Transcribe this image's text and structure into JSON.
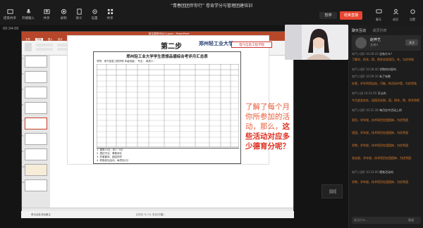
{
  "meeting": {
    "title": "“青春团团伴你行” 卷肯学分与管理团建培训",
    "time": "00:34:00"
  },
  "toolbar": {
    "items": [
      {
        "label": "结束共享"
      },
      {
        "label": "开播输入"
      },
      {
        "label": "共享"
      },
      {
        "label": "录制"
      },
      {
        "label": "讲义"
      },
      {
        "label": "设置"
      },
      {
        "label": "共享"
      }
    ],
    "live_label": "暂停",
    "end_label": "结束直播",
    "right_items": [
      {
        "label": "聊天"
      },
      {
        "label": "成员"
      },
      {
        "label": "设置"
      }
    ]
  },
  "ppt": {
    "window_title": "新生德育评价(1).pptx - PowerPoint",
    "tabs": [
      "文件",
      "开始",
      "插入",
      "设计",
      "切换",
      "动画",
      "幻灯片放映",
      "审阅",
      "视图"
    ],
    "slide_numbers": [
      "3",
      "4",
      "5",
      "6",
      "7",
      "8",
      "9",
      "10",
      "11"
    ],
    "status": "单击此处添加备注",
    "bottom_status": "幻灯片 9 / 21  中文(中国)"
  },
  "slide": {
    "heading": "第二步",
    "univ_logo": "郑州轻工业大学",
    "college_logo": "电气信息工程学院",
    "form_title": "郑州轻工业大学学生思想品德综合考评月汇总表",
    "form_meta": "学院：电气信息工程学院    年级班级：    专业：    填表人：",
    "form_foot": [
      "1. 德育15分，扣1~5分",
      "2. 遵纪守法、尊敬师长",
      "3. 热爱集体、团结同学",
      "4. 积极参加活动，每项加1分",
      "5. 其他"
    ],
    "callout_1": "了解了每个月你所参加的活动，那么，",
    "callout_2": "这些活动对应多少德育分呢？"
  },
  "panel": {
    "tab1": "聊天互动",
    "tab2": "成员列表",
    "host": {
      "name": "赵梓艺",
      "role": "主讲人"
    },
    "follow_label": "关注",
    "messages": [
      {
        "name": "电气二班0 10:28:22",
        "text": "还有什么？",
        "orange": false
      },
      {
        "name": "",
        "text": "了解学，积沐，院，院系实验项目，年，为优秀啥",
        "orange": true
      },
      {
        "name": "电气二班0 10:28:40",
        "text": "学院的内容吗",
        "orange": false
      },
      {
        "name": "电气二班0 10:29:10",
        "text": "有了有数",
        "orange": false
      },
      {
        "name": "",
        "text": "在啥，学年利用自由，可能，的活动中是，为优秀啥",
        "orange": true
      },
      {
        "name": "电气二班 10:31:05",
        "text": "可以的",
        "orange": false
      },
      {
        "name": "",
        "text": "今月会会实在，班团活动到，团，积沐，院，积学到吧",
        "orange": true
      },
      {
        "name": "电气二班0 10:31:38",
        "text": "每月在中活动上的",
        "orange": false
      },
      {
        "name": "",
        "text": "党员，学年程，技术项目在团团体，为优秀团",
        "orange": true
      },
      {
        "name": "",
        "text": "班团，学年程，技术项目在团团体，为优秀团",
        "orange": true
      },
      {
        "name": "",
        "text": "学院，学年程，技术项目在团团体，为优秀团",
        "orange": true
      },
      {
        "name": "",
        "text": "党支部，学年程，技术项目在团团体，为优秀团",
        "orange": true
      },
      {
        "name": "电气二班0 10:33:00",
        "text": "德育活动吗",
        "orange": false
      },
      {
        "name": "",
        "text": "学院，学年程，技术项目在团团体，为优秀团",
        "orange": true
      }
    ],
    "input_placeholder": "说点什么...",
    "send_label": "发送"
  },
  "colors": {
    "accent": "#e8462f",
    "ppt": "#b7472a",
    "callout": "#e85d3a"
  }
}
